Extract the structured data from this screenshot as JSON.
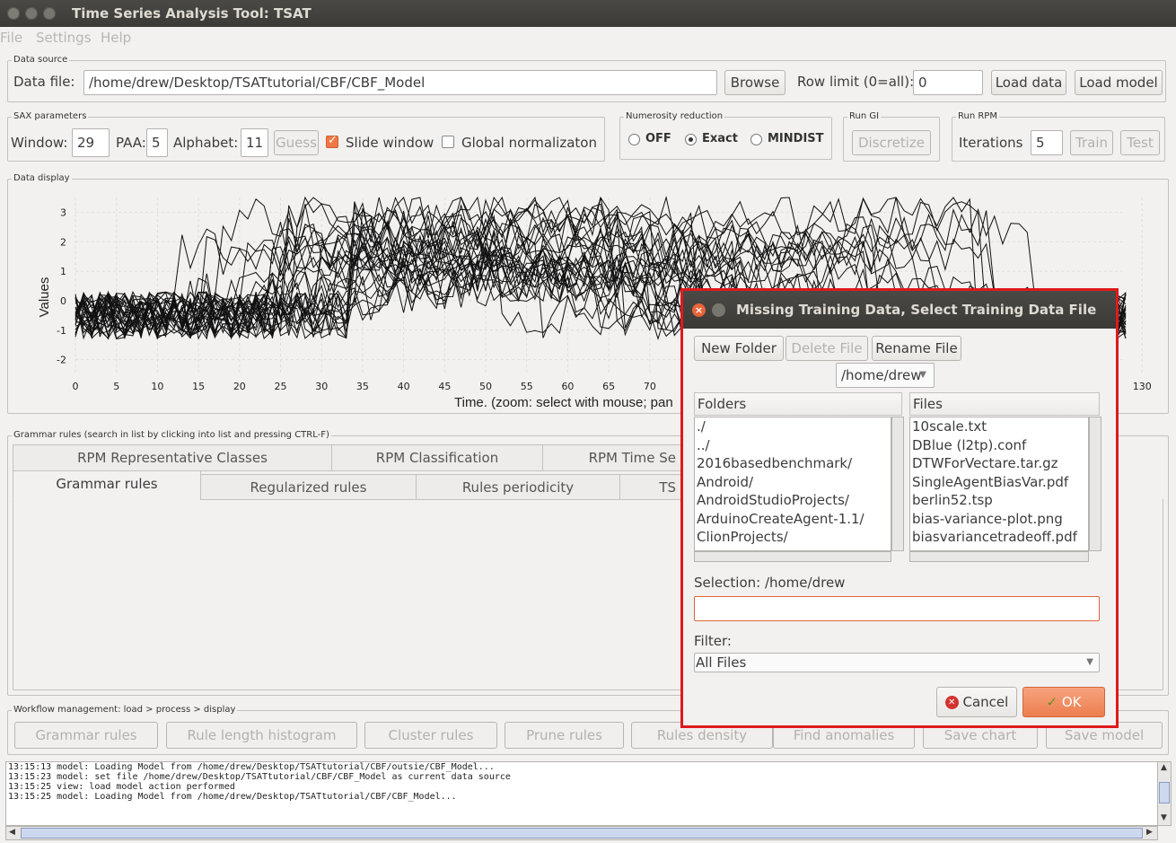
{
  "window": {
    "title": "Time Series Analysis Tool: TSAT"
  },
  "menu": {
    "file": "File",
    "settings": "Settings",
    "help": "Help"
  },
  "data_source": {
    "group_label": "Data source",
    "file_label": "Data file:",
    "file_value": "/home/drew/Desktop/TSATtutorial/CBF/CBF_Model",
    "browse": "Browse",
    "row_limit_label": "Row limit (0=all):",
    "row_limit_value": "0",
    "load_data": "Load data",
    "load_model": "Load model"
  },
  "sax": {
    "group_label": "SAX parameters",
    "window_label": "Window:",
    "window_value": "29",
    "paa_label": "PAA:",
    "paa_value": "5",
    "alphabet_label": "Alphabet:",
    "alphabet_value": "11",
    "guess": "Guess",
    "slide_window": "Slide window",
    "slide_window_checked": true,
    "global_norm": "Global normalizaton",
    "global_norm_checked": false
  },
  "numerosity": {
    "group_label": "Numerosity reduction",
    "options": [
      "OFF",
      "Exact",
      "MINDIST"
    ],
    "selected": "Exact"
  },
  "run_gi": {
    "group_label": "Run GI",
    "discretize": "Discretize"
  },
  "run_rpm": {
    "group_label": "Run RPM",
    "iterations_label": "Iterations",
    "iterations_value": "5",
    "train": "Train",
    "test": "Test"
  },
  "chart_data": {
    "type": "line",
    "group_label": "Data display",
    "ylabel": "Values",
    "xlabel": "Time. (zoom: select with mouse; pan",
    "x_ticks": [
      "0",
      "5",
      "10",
      "15",
      "20",
      "25",
      "30",
      "35",
      "40",
      "45",
      "50",
      "55",
      "60",
      "65",
      "70",
      "130"
    ],
    "y_ticks": [
      "3",
      "2",
      "1",
      "0",
      "-1",
      "-2"
    ],
    "xlim": [
      0,
      128
    ],
    "ylim": [
      -2.5,
      3.5
    ],
    "grid": true,
    "series_count": 30
  },
  "grammar": {
    "group_label": "Grammar rules (search in list by clicking into list and pressing CTRL-F)",
    "tabs_row1": [
      "RPM Representative Classes",
      "RPM Classification",
      "RPM Time Se"
    ],
    "tabs_row2": [
      "Grammar rules",
      "Regularized rules",
      "Rules periodicity",
      "TS"
    ],
    "selected_tab": "Grammar rules"
  },
  "workflow": {
    "group_label": "Workflow management: load > process > display",
    "buttons": [
      "Grammar rules",
      "Rule length histogram",
      "Cluster rules",
      "Prune rules",
      "Rules density",
      "Find anomalies",
      "Save chart",
      "Save model"
    ]
  },
  "log": {
    "lines": [
      "13:15:13 model: Loading Model from /home/drew/Desktop/TSATtutorial/CBF/outsie/CBF_Model...",
      "13:15:23 model: set file /home/drew/Desktop/TSATtutorial/CBF/CBF_Model as current data source",
      "13:15:25 view: load model action performed",
      "13:15:25 model: Loading Model from /home/drew/Desktop/TSATtutorial/CBF/CBF_Model..."
    ]
  },
  "dialog": {
    "title": "Missing Training Data, Select Training Data File",
    "new_folder": "New Folder",
    "delete_file": "Delete File",
    "rename_file": "Rename File",
    "path": "/home/drew",
    "folders_header": "Folders",
    "files_header": "Files",
    "folders": [
      "./",
      "../",
      "2016basedbenchmark/",
      "Android/",
      "AndroidStudioProjects/",
      "ArduinoCreateAgent-1.1/",
      "ClionProjects/"
    ],
    "files": [
      "10scale.txt",
      "DBlue (l2tp).conf",
      "DTWForVectare.tar.gz",
      "SingleAgentBiasVar.pdf",
      "berlin52.tsp",
      "bias-variance-plot.png",
      "biasvariancetradeoff.pdf"
    ],
    "selection_label": "Selection: /home/drew",
    "selection_value": "",
    "filter_label": "Filter:",
    "filter_value": "All Files",
    "cancel": "Cancel",
    "ok": "OK"
  },
  "colors": {
    "accent": "#f07746",
    "highlight": "#e0191c",
    "titlebar": "#3c3b37"
  }
}
